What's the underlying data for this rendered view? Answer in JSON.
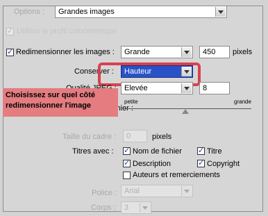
{
  "options_label": "Options :",
  "options_select": "Grandes images",
  "hidden_checkbox_label": "Utiliser le profil colorimétrique",
  "resize": {
    "label": "Redimensionner les images :",
    "size_select": "Grande",
    "size_value": "450",
    "unit": "pixels"
  },
  "keep": {
    "label": "Conserver :",
    "select": "Hauteur"
  },
  "jpeg": {
    "label": "Qualité JPEG :",
    "select": "Elevée",
    "value": "8"
  },
  "filesize": {
    "label": "Taille du fichier :",
    "min_label": "petite",
    "max_label": "grande",
    "position": 0.48
  },
  "border": {
    "label": "Taille du cadre :",
    "value": "0",
    "unit": "pixels"
  },
  "titles": {
    "label": "Titres avec :",
    "items": [
      {
        "label": "Nom de fichier",
        "checked": true
      },
      {
        "label": "Titre",
        "checked": true
      },
      {
        "label": "Description",
        "checked": true
      },
      {
        "label": "Copyright",
        "checked": true
      },
      {
        "label": "Auteurs et remerciements",
        "checked": false
      }
    ]
  },
  "font": {
    "label": "Police :",
    "select": "Arial"
  },
  "size": {
    "label": "Corps :",
    "select": "3"
  },
  "callout_text": "Choisissez sur quel côté redimensionner l'image",
  "colors": {
    "callout_bg": "#e47c80",
    "highlight_border": "#d94050",
    "selection_blue": "#2a52c8"
  }
}
